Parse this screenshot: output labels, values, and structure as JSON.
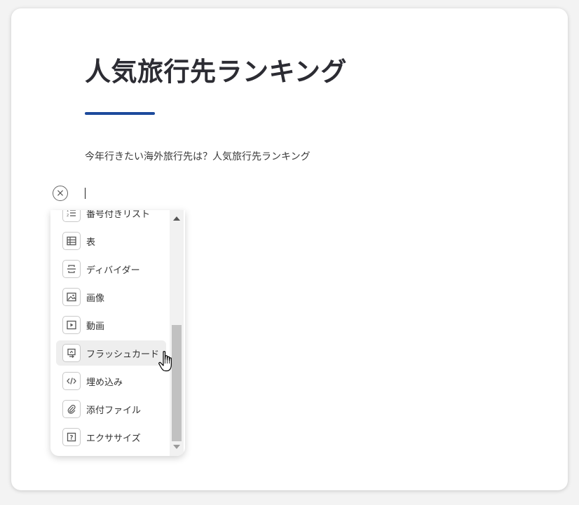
{
  "page": {
    "title": "人気旅行先ランキング",
    "subtitle": "今年行きたい海外旅行先は？人気旅行先ランキング",
    "close_icon": "×"
  },
  "menu": {
    "items": [
      {
        "label": "番号付きリスト",
        "icon": "numbered-list-icon"
      },
      {
        "label": "表",
        "icon": "table-icon"
      },
      {
        "label": "ディバイダー",
        "icon": "divider-icon"
      },
      {
        "label": "画像",
        "icon": "image-icon"
      },
      {
        "label": "動画",
        "icon": "video-icon"
      },
      {
        "label": "フラッシュカード",
        "icon": "flashcard-icon"
      },
      {
        "label": "埋め込み",
        "icon": "embed-icon"
      },
      {
        "label": "添付ファイル",
        "icon": "attachment-icon"
      },
      {
        "label": "エクササイズ",
        "icon": "exercise-icon"
      }
    ],
    "hovered_item": "フラッシュカード"
  },
  "colors": {
    "accent": "#1c4a9c",
    "title_text": "#2c2c33",
    "hover_bg": "#eeeeee"
  }
}
